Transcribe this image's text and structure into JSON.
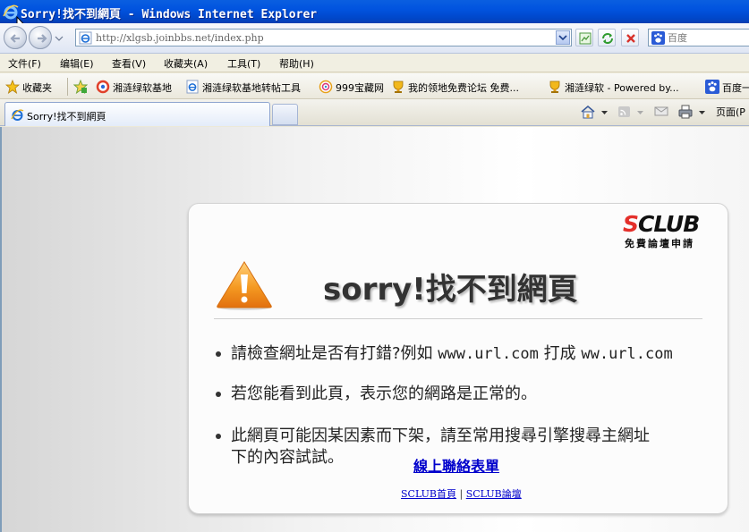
{
  "window": {
    "title": "Sorry!找不到網頁 - Windows Internet Explorer"
  },
  "address_bar": {
    "url": "http://xlgsb.joinbbs.net/index.php",
    "search_placeholder": "百度"
  },
  "menu": {
    "items": [
      "文件(F)",
      "编辑(E)",
      "查看(V)",
      "收藏夹(A)",
      "工具(T)",
      "帮助(H)"
    ]
  },
  "favorites": {
    "label": "收藏夹",
    "items": [
      "湘涟绿软基地",
      "湘涟绿软基地转帖工具",
      "999宝藏网",
      "我的领地免费论坛 免费...",
      "湘涟绿软 - Powered by...",
      "百度一"
    ]
  },
  "tabs": {
    "active_label": "Sorry!找不到網頁",
    "page_menu_label": "页面(P"
  },
  "page": {
    "logo_brand_s": "S",
    "logo_brand_rest": "CLUB",
    "logo_slogan": "免費論壇申請",
    "heading": "sorry!找不到網頁",
    "messages": {
      "line1_text": "請檢查網址是否有打錯?例如",
      "line1_example1": "www.url.com",
      "line1_mid": "打成",
      "line1_example2": "ww.url.com",
      "line2": "若您能看到此頁，表示您的網路是正常的。",
      "line3a": "此網頁可能因某因素而下架，請至常用搜尋引擎搜尋主網址",
      "line3b": "下的內容試試。"
    },
    "contact_link": "線上聯絡表單",
    "footer": {
      "home_link": "SCLUB首頁",
      "separator": "|",
      "forum_link": "SCLUB論壇"
    }
  },
  "colors": {
    "title_bar": "#0153df",
    "link": "#0000cc",
    "warning": "#f08a1a",
    "logo_accent": "#e4302b"
  }
}
